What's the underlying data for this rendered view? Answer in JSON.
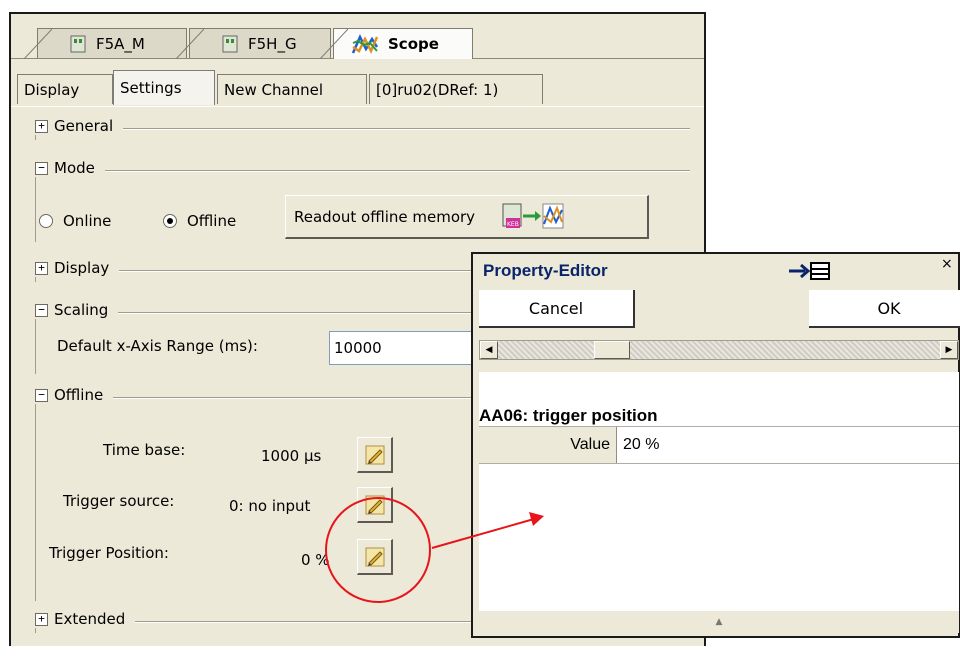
{
  "doc_tabs": [
    {
      "label": "F5A_M",
      "icon": "device-icon"
    },
    {
      "label": "F5H_G",
      "icon": "device-icon"
    },
    {
      "label": "Scope",
      "icon": "scope-icon",
      "active": true
    }
  ],
  "settings_tabs": [
    "Display",
    "Settings",
    "New Channel",
    "[0]ru02(DRef: 1)"
  ],
  "sections": {
    "general": {
      "label": "General",
      "toggle": "⊞"
    },
    "mode": {
      "label": "Mode",
      "toggle": "⊟"
    },
    "display": {
      "label": "Display",
      "toggle": "⊞"
    },
    "scaling": {
      "label": "Scaling",
      "toggle": "⊟"
    },
    "offline": {
      "label": "Offline",
      "toggle": "⊟"
    },
    "extended": {
      "label": "Extended",
      "toggle": "⊞"
    }
  },
  "mode": {
    "online_label": "Online",
    "offline_label": "Offline",
    "selected": "Offline",
    "readout_button": "Readout offline memory"
  },
  "scaling": {
    "x_range_label": "Default x-Axis Range (ms):",
    "x_range_value": "10000"
  },
  "offline": {
    "time_base_label": "Time base:",
    "time_base_value": "1000 µs",
    "trigger_source_label": "Trigger source:",
    "trigger_source_value": "0: no input",
    "trigger_position_label": "Trigger Position:",
    "trigger_position_value": "0 %"
  },
  "property_editor": {
    "title": "Property-Editor",
    "cancel_label": "Cancel",
    "ok_label": "OK",
    "property_title": "AA06: trigger position",
    "key_label": "Value",
    "value": "20 %"
  },
  "colors": {
    "panel_bg": "#ece9d8",
    "annotation": "#e8141c",
    "title_text": "#0a246a"
  }
}
